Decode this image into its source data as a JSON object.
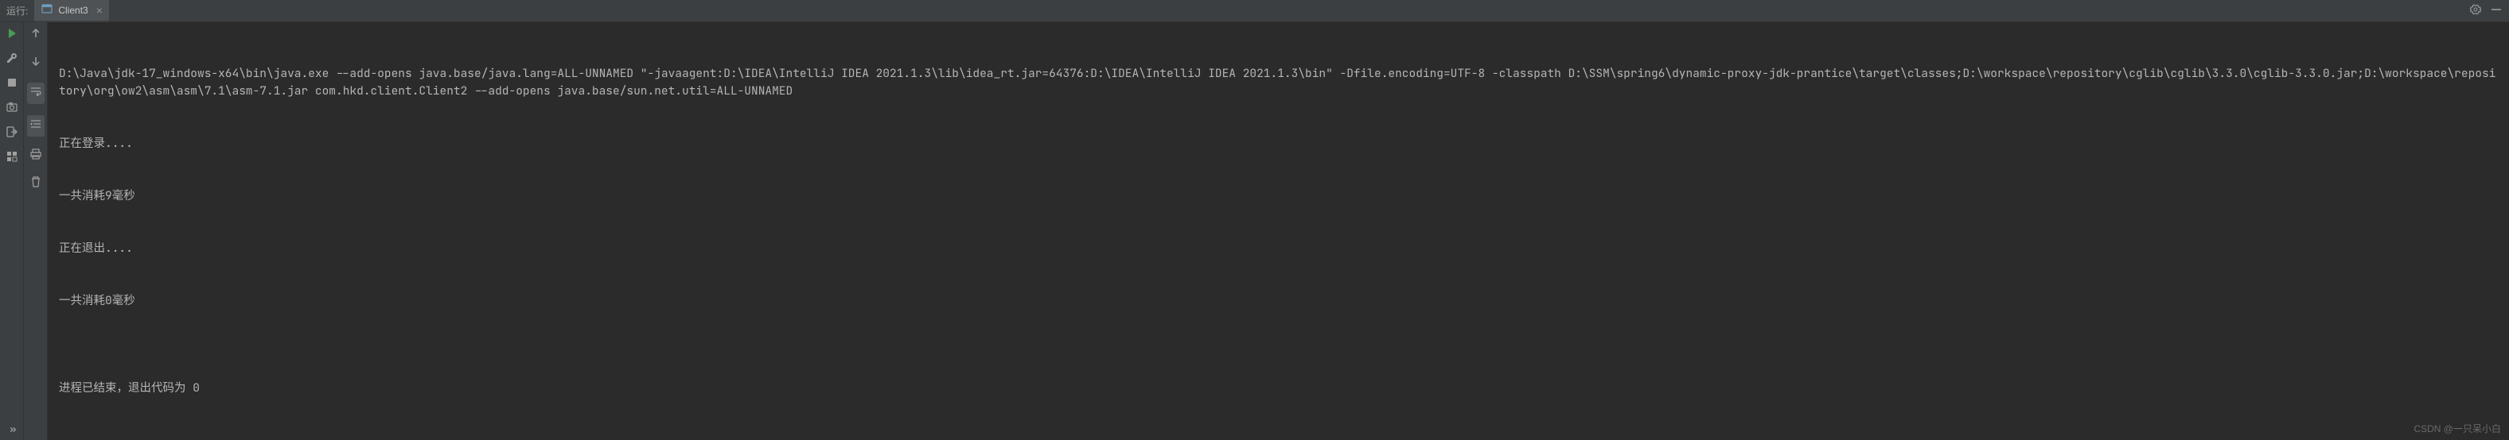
{
  "header": {
    "run_label": "运行:",
    "tab_name": "Client3"
  },
  "console": {
    "lines": [
      "D:\\Java\\jdk-17_windows-x64\\bin\\java.exe --add-opens java.base/java.lang=ALL-UNNAMED \"-javaagent:D:\\IDEA\\IntelliJ IDEA 2021.1.3\\lib\\idea_rt.jar=64376:D:\\IDEA\\IntelliJ IDEA 2021.1.3\\bin\" -Dfile.encoding=UTF-8 -classpath D:\\SSM\\spring6\\dynamic-proxy-jdk-prantice\\target\\classes;D:\\workspace\\repository\\cglib\\cglib\\3.3.0\\cglib-3.3.0.jar;D:\\workspace\\repository\\org\\ow2\\asm\\asm\\7.1\\asm-7.1.jar com.hkd.client.Client2 --add-opens java.base/sun.net.util=ALL-UNNAMED",
      "正在登录....",
      "一共消耗9毫秒",
      "正在退出....",
      "一共消耗0毫秒",
      "",
      "进程已结束，退出代码为 0"
    ]
  },
  "watermark": "CSDN @一只呆小白",
  "icons": {
    "run": "run",
    "stop": "stop",
    "settings": "gear",
    "minimize": "minimize"
  },
  "colors": {
    "background": "#2b2b2b",
    "panel": "#3c3f41",
    "text": "#bbbbbb",
    "run_green": "#499c54"
  }
}
